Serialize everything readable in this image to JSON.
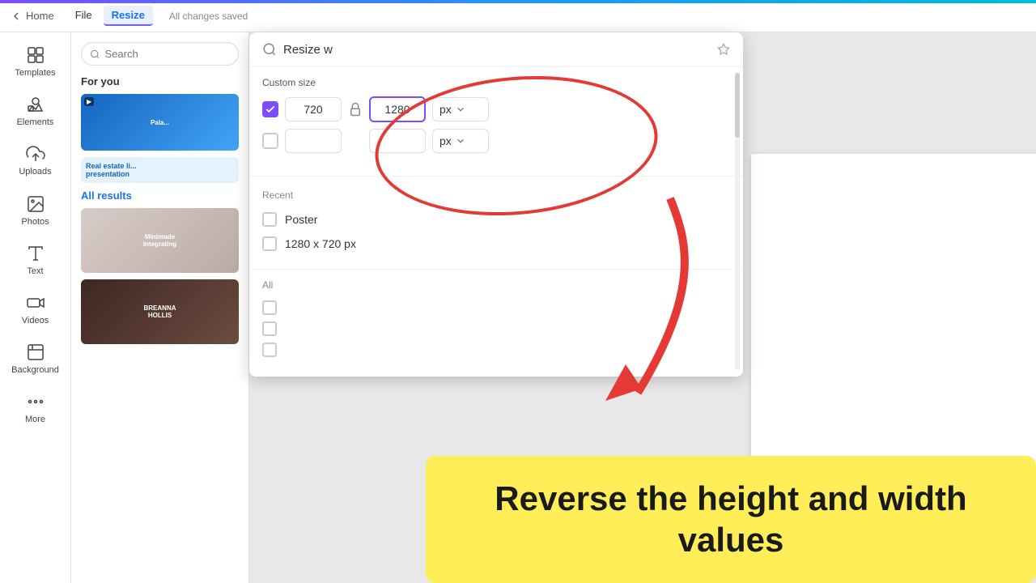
{
  "topbar": {
    "back_label": "Home",
    "nav_items": [
      "Home",
      "File",
      "Resize"
    ],
    "active_nav": "Resize",
    "saved_status": "All changes saved"
  },
  "sidebar": {
    "items": [
      {
        "id": "templates",
        "label": "Templates",
        "icon": "grid"
      },
      {
        "id": "elements",
        "label": "Elements",
        "icon": "shapes"
      },
      {
        "id": "uploads",
        "label": "Uploads",
        "icon": "upload"
      },
      {
        "id": "photos",
        "label": "Photos",
        "icon": "photo"
      },
      {
        "id": "text",
        "label": "Text",
        "icon": "text"
      },
      {
        "id": "videos",
        "label": "Videos",
        "icon": "video"
      },
      {
        "id": "background",
        "label": "Background",
        "icon": "background"
      },
      {
        "id": "more",
        "label": "More",
        "icon": "more"
      }
    ]
  },
  "left_panel": {
    "search_placeholder": "Search",
    "for_you_label": "For you",
    "all_results_label": "All results"
  },
  "resize_panel": {
    "title": "Resize w",
    "custom_size_label": "Custom size",
    "width_value": "720",
    "height_value": "1280",
    "unit_label": "px",
    "recent_label": "Recent",
    "recent_items": [
      {
        "label": "Poster"
      },
      {
        "label": "1280 x 720 px"
      }
    ],
    "all_label": "All",
    "all_items": [
      {
        "label": ""
      },
      {
        "label": ""
      },
      {
        "label": ""
      }
    ]
  },
  "yellow_box": {
    "text": "Reverse the height and width values"
  }
}
